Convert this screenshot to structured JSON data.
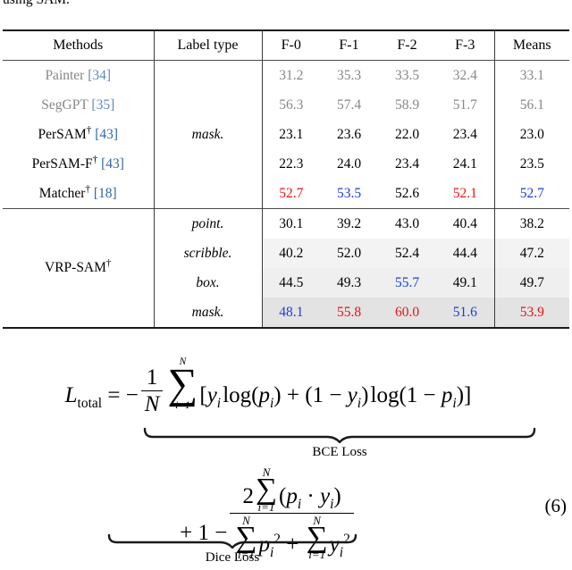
{
  "caption_tail": "using SAM.",
  "table": {
    "columns": [
      "Methods",
      "Label type",
      "F-0",
      "F-1",
      "F-2",
      "F-3",
      "Means"
    ],
    "groups": [
      {
        "label_type": "mask.",
        "rows": [
          {
            "method": "Painter",
            "dagger": "",
            "cite": "[34]",
            "style": "grey",
            "values": [
              "31.2",
              "35.3",
              "33.5",
              "32.4"
            ],
            "means": "33.1",
            "value_colors": [
              "grey",
              "grey",
              "grey",
              "grey"
            ],
            "means_color": "grey",
            "shade": "sh0"
          },
          {
            "method": "SegGPT",
            "dagger": "",
            "cite": "[35]",
            "style": "grey",
            "values": [
              "56.3",
              "57.4",
              "58.9",
              "51.7"
            ],
            "means": "56.1",
            "value_colors": [
              "grey",
              "grey",
              "grey",
              "grey"
            ],
            "means_color": "grey",
            "shade": "sh0"
          },
          {
            "method": "PerSAM",
            "dagger": "†",
            "cite": "[43]",
            "style": "normal",
            "values": [
              "23.1",
              "23.6",
              "22.0",
              "23.4"
            ],
            "means": "23.0",
            "value_colors": [
              "",
              "",
              "",
              ""
            ],
            "means_color": "",
            "shade": "sh0"
          },
          {
            "method": "PerSAM-F",
            "dagger": "†",
            "cite": "[43]",
            "style": "normal",
            "values": [
              "22.3",
              "24.0",
              "23.4",
              "24.1"
            ],
            "means": "23.5",
            "value_colors": [
              "",
              "",
              "",
              ""
            ],
            "means_color": "",
            "shade": "sh0"
          },
          {
            "method": "Matcher",
            "dagger": "†",
            "cite": "[18]",
            "style": "normal",
            "values": [
              "52.7",
              "53.5",
              "52.6",
              "52.1"
            ],
            "means": "52.7",
            "value_colors": [
              "red",
              "blue",
              "",
              "red"
            ],
            "means_color": "blue",
            "shade": "sh0"
          }
        ]
      },
      {
        "method": "VRP-SAM",
        "dagger": "†",
        "rows": [
          {
            "label_type": "point.",
            "values": [
              "30.1",
              "39.2",
              "43.0",
              "40.4"
            ],
            "means": "38.2",
            "value_colors": [
              "",
              "",
              "",
              ""
            ],
            "means_color": "",
            "shade": "sh0"
          },
          {
            "label_type": "scribble.",
            "values": [
              "40.2",
              "52.0",
              "52.4",
              "44.4"
            ],
            "means": "47.2",
            "value_colors": [
              "",
              "",
              "",
              ""
            ],
            "means_color": "",
            "shade": "sh1"
          },
          {
            "label_type": "box.",
            "values": [
              "44.5",
              "49.3",
              "55.7",
              "49.1"
            ],
            "means": "49.7",
            "value_colors": [
              "",
              "",
              "blue",
              ""
            ],
            "means_color": "",
            "shade": "sh2"
          },
          {
            "label_type": "mask.",
            "values": [
              "48.1",
              "55.8",
              "60.0",
              "51.6"
            ],
            "means": "53.9",
            "value_colors": [
              "blue",
              "red",
              "red",
              "blue"
            ],
            "means_color": "red",
            "shade": "sh3"
          }
        ]
      }
    ]
  },
  "equation": {
    "number": "(6)",
    "lhs": "L",
    "lhs_sub": "total",
    "eq_sign": "=",
    "minus": "−",
    "frac_num": "1",
    "frac_den": "N",
    "sum_upper": "N",
    "sum_lower": "i=1",
    "sigma": "∑",
    "bce_expr_open": "[",
    "bce_y": "y",
    "bce_log1": "log(",
    "bce_p": "p",
    "bce_close1": ")",
    "bce_plus": "+",
    "bce_one": "(1",
    "bce_minus": "−",
    "bce_y2": "y",
    "bce_close2": ")",
    "bce_log2": "log(1",
    "bce_minus2": "−",
    "bce_p2": "p",
    "bce_close3": ")]",
    "brace1_label": "BCE Loss",
    "line2_plus": "+",
    "line2_one": "1",
    "line2_minus": "−",
    "dice_num_two": "2",
    "dice_dot": "·",
    "dice_p": "p",
    "dice_y": "y",
    "dice_plus": "+",
    "brace2_label": "Dice Loss",
    "sub_i": "i",
    "pow_2": "2"
  },
  "colors": {
    "citation_blue": "#3465a4",
    "highlight_red": "#ee1111",
    "highlight_blue": "#1a3fd6",
    "muted_grey": "#878787",
    "rule_dark": "#1a1a1a"
  }
}
